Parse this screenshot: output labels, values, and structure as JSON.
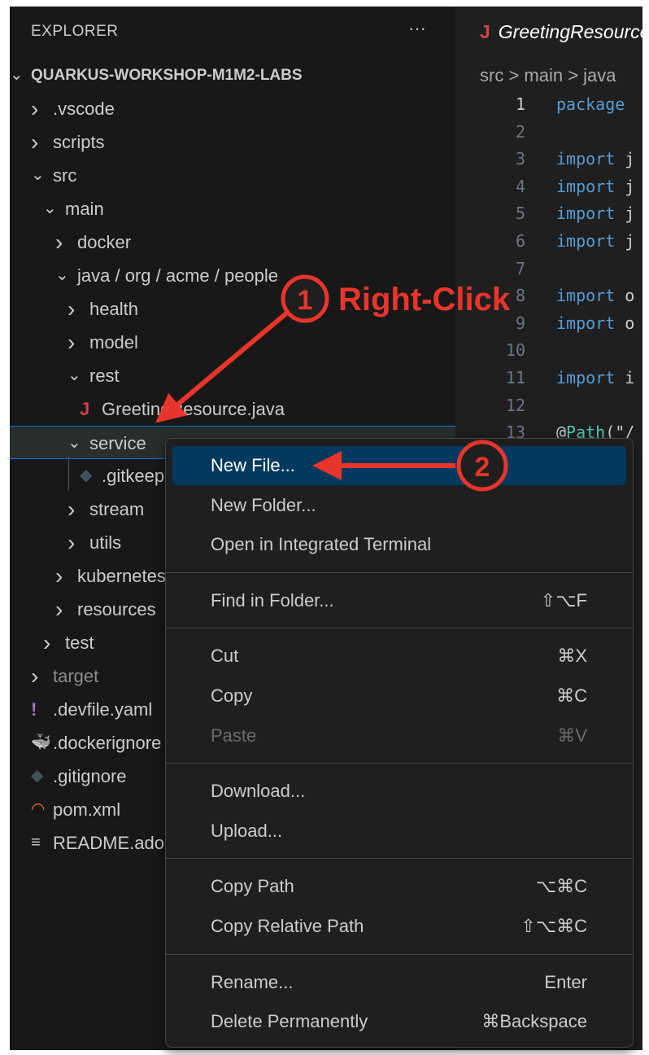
{
  "explorer": {
    "title": "EXPLORER",
    "more": "···",
    "root": "QUARKUS-WORKSHOP-M1M2-LABS",
    "items": [
      {
        "label": ".vscode",
        "type": "folder",
        "expanded": false,
        "depth": 1
      },
      {
        "label": "scripts",
        "type": "folder",
        "expanded": false,
        "depth": 1
      },
      {
        "label": "src",
        "type": "folder",
        "expanded": true,
        "depth": 1
      },
      {
        "label": "main",
        "type": "folder",
        "expanded": true,
        "depth": 2
      },
      {
        "label": "docker",
        "type": "folder",
        "expanded": false,
        "depth": 3
      },
      {
        "label": "java / org / acme / people",
        "type": "folder",
        "expanded": true,
        "depth": 3
      },
      {
        "label": "health",
        "type": "folder",
        "expanded": false,
        "depth": 4
      },
      {
        "label": "model",
        "type": "folder",
        "expanded": false,
        "depth": 4
      },
      {
        "label": "rest",
        "type": "folder",
        "expanded": true,
        "depth": 4
      },
      {
        "label": "GreetingResource.java",
        "type": "java",
        "depth": 5
      },
      {
        "label": "service",
        "type": "folder",
        "expanded": true,
        "depth": 4,
        "selected": true
      },
      {
        "label": ".gitkeep",
        "type": "git",
        "depth": 5
      },
      {
        "label": "stream",
        "type": "folder",
        "expanded": false,
        "depth": 4
      },
      {
        "label": "utils",
        "type": "folder",
        "expanded": false,
        "depth": 4
      },
      {
        "label": "kubernetes",
        "type": "folder",
        "expanded": false,
        "depth": 3
      },
      {
        "label": "resources",
        "type": "folder",
        "expanded": false,
        "depth": 3
      },
      {
        "label": "test",
        "type": "folder",
        "expanded": false,
        "depth": 2
      },
      {
        "label": "target",
        "type": "folder",
        "expanded": false,
        "depth": 1,
        "dimmed": true
      },
      {
        "label": ".devfile.yaml",
        "type": "yaml",
        "depth": 1
      },
      {
        "label": ".dockerignore",
        "type": "docker",
        "depth": 1
      },
      {
        "label": ".gitignore",
        "type": "git",
        "depth": 1
      },
      {
        "label": "pom.xml",
        "type": "rss",
        "depth": 1
      },
      {
        "label": "README.adoc",
        "type": "text",
        "depth": 1
      }
    ]
  },
  "editor": {
    "tab_title": "GreetingResource.java",
    "tab_icon": "J",
    "breadcrumb": "src > main > java",
    "lines": [
      {
        "n": "1",
        "tokens": [
          [
            "kw",
            "package"
          ]
        ]
      },
      {
        "n": "2",
        "tokens": []
      },
      {
        "n": "3",
        "tokens": [
          [
            "kw",
            "import"
          ],
          [
            "",
            "j"
          ]
        ]
      },
      {
        "n": "4",
        "tokens": [
          [
            "kw",
            "import"
          ],
          [
            "",
            "j"
          ]
        ]
      },
      {
        "n": "5",
        "tokens": [
          [
            "kw",
            "import"
          ],
          [
            "",
            "j"
          ]
        ]
      },
      {
        "n": "6",
        "tokens": [
          [
            "kw",
            "import"
          ],
          [
            "",
            "j"
          ]
        ]
      },
      {
        "n": "7",
        "tokens": []
      },
      {
        "n": "8",
        "tokens": [
          [
            "kw",
            "import"
          ],
          [
            "",
            "o"
          ]
        ]
      },
      {
        "n": "9",
        "tokens": [
          [
            "kw",
            "import"
          ],
          [
            "",
            "o"
          ]
        ]
      },
      {
        "n": "10",
        "tokens": []
      },
      {
        "n": "11",
        "tokens": [
          [
            "kw",
            "import"
          ],
          [
            "",
            "i"
          ]
        ]
      },
      {
        "n": "12",
        "tokens": []
      },
      {
        "n": "13",
        "tokens": [
          [
            "",
            "@"
          ],
          [
            "ann",
            "Path"
          ],
          [
            "",
            "(\"/"
          ]
        ]
      }
    ]
  },
  "context_menu": {
    "groups": [
      [
        {
          "label": "New File...",
          "highlighted": true
        },
        {
          "label": "New Folder..."
        },
        {
          "label": "Open in Integrated Terminal"
        }
      ],
      [
        {
          "label": "Find in Folder...",
          "shortcut": "⇧⌥F"
        }
      ],
      [
        {
          "label": "Cut",
          "shortcut": "⌘X"
        },
        {
          "label": "Copy",
          "shortcut": "⌘C"
        },
        {
          "label": "Paste",
          "shortcut": "⌘V",
          "disabled": true
        }
      ],
      [
        {
          "label": "Download..."
        },
        {
          "label": "Upload..."
        }
      ],
      [
        {
          "label": "Copy Path",
          "shortcut": "⌥⌘C"
        },
        {
          "label": "Copy Relative Path",
          "shortcut": "⇧⌥⌘C"
        }
      ],
      [
        {
          "label": "Rename...",
          "shortcut": "Enter"
        },
        {
          "label": "Delete Permanently",
          "shortcut": "⌘Backspace"
        }
      ]
    ]
  },
  "annotations": {
    "step1_number": "1",
    "step1_label": "Right-Click",
    "step2_number": "2",
    "color": "#e8352b"
  }
}
